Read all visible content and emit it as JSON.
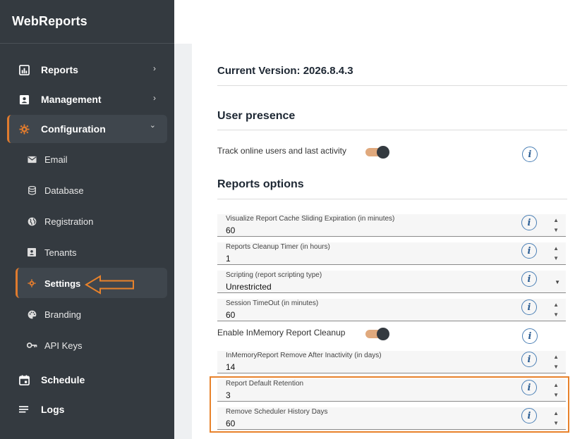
{
  "app": {
    "title": "WebReports"
  },
  "sidebar": {
    "items": [
      {
        "label": "Reports",
        "icon": "bar-chart-icon",
        "chevron": "›"
      },
      {
        "label": "Management",
        "icon": "contact-card-icon",
        "chevron": "›"
      },
      {
        "label": "Configuration",
        "icon": "gear-icon",
        "chevron": "⌄"
      },
      {
        "label": "Email",
        "icon": "envelope-icon"
      },
      {
        "label": "Database",
        "icon": "database-icon"
      },
      {
        "label": "Registration",
        "icon": "globe-icon"
      },
      {
        "label": "Tenants",
        "icon": "id-badge-icon"
      },
      {
        "label": "Settings",
        "icon": "gear-icon"
      },
      {
        "label": "Branding",
        "icon": "palette-icon"
      },
      {
        "label": "API Keys",
        "icon": "key-icon"
      },
      {
        "label": "Schedule",
        "icon": "calendar-icon"
      },
      {
        "label": "Logs",
        "icon": "list-icon"
      }
    ]
  },
  "main": {
    "version": "Current Version: 2026.8.4.3",
    "user_presence": {
      "heading": "User presence",
      "toggle_label": "Track online users and last activity",
      "toggle_on": true
    },
    "reports_options": {
      "heading": "Reports options",
      "fields": [
        {
          "label": "Visualize Report Cache Sliding Expiration (in minutes)",
          "value": "60",
          "type": "number"
        },
        {
          "label": "Reports Cleanup Timer (in hours)",
          "value": "1",
          "type": "number"
        },
        {
          "label": "Scripting (report scripting type)",
          "value": "Unrestricted",
          "type": "select"
        },
        {
          "label": "Session TimeOut (in minutes)",
          "value": "60",
          "type": "number"
        }
      ],
      "inmemory_toggle_label": "Enable InMemory Report Cleanup",
      "inmemory_toggle_on": true,
      "fields2": [
        {
          "label": "InMemoryReport Remove After Inactivity (in days)",
          "value": "14",
          "type": "number"
        },
        {
          "label": "Report Default Retention",
          "value": "3",
          "type": "number"
        },
        {
          "label": "Remove Scheduler History Days",
          "value": "60",
          "type": "number"
        }
      ]
    }
  },
  "colors": {
    "sidebar_bg": "#343a40",
    "accent": "#e07b2e",
    "toggle_track": "#e0a97d",
    "info": "#2e5f94"
  }
}
